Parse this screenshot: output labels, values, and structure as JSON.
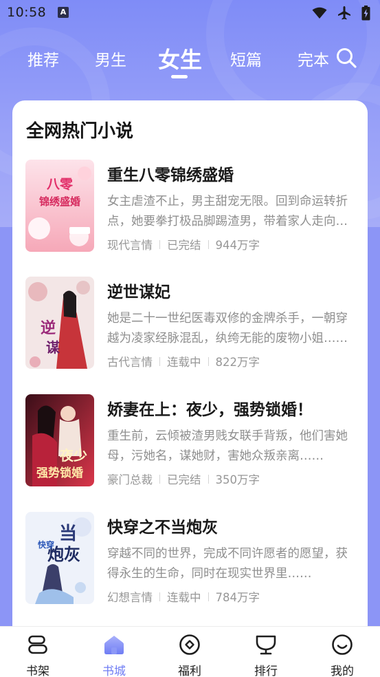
{
  "status_bar": {
    "time": "10:58",
    "notification_badge": "A",
    "icons": [
      "wifi-icon",
      "airplane-mode-icon",
      "battery-charging-icon"
    ]
  },
  "tabs": [
    {
      "label": "推荐",
      "active": false
    },
    {
      "label": "男生",
      "active": false
    },
    {
      "label": "女生",
      "active": true
    },
    {
      "label": "短篇",
      "active": false
    },
    {
      "label": "完本",
      "active": false
    }
  ],
  "search": {
    "icon": "search-icon"
  },
  "section": {
    "title": "全网热门小说"
  },
  "books": [
    {
      "title": "重生八零锦绣盛婚",
      "description": "女主虐渣不止，男主甜宠无限。回到命运转折点，她要拳打极品脚踢渣男，带着家人走向致富之路……",
      "category": "现代言情",
      "status": "已完结",
      "word_count": "944万字",
      "cover_text": "重生八零锦绣盛婚",
      "cover_colors": [
        "#f6a8b8",
        "#fde3ea"
      ]
    },
    {
      "title": "逆世谋妃",
      "description": "她是二十一世纪医毒双修的金牌杀手，一朝穿越为凌家经脉混乱，纨绔无能的废物小姐……",
      "category": "古代言情",
      "status": "连载中",
      "word_count": "822万字",
      "cover_text": "逆世谋妃",
      "cover_colors": [
        "#f0d6d8",
        "#c23a3a"
      ]
    },
    {
      "title": "娇妻在上：夜少，强势锁婚！",
      "description": "重生前，云倾被渣男贱女联手背叛，他们害她母，污她名，谋她财，害她众叛亲离……",
      "category": "豪门总裁",
      "status": "已完结",
      "word_count": "350万字",
      "cover_text": "夜少强势锁婚",
      "cover_colors": [
        "#d9364a",
        "#4a1020"
      ]
    },
    {
      "title": "快穿之不当炮灰",
      "description": "穿越不同的世界，完成不同许愿者的愿望，获得永生的生命，同时在现实世界里……",
      "category": "幻想言情",
      "status": "连载中",
      "word_count": "784万字",
      "cover_text": "快穿之不当炮灰",
      "cover_colors": [
        "#e8eef8",
        "#2b3a78"
      ]
    }
  ],
  "bottom_nav": [
    {
      "label": "书架",
      "icon": "bookshelf-icon",
      "active": false
    },
    {
      "label": "书城",
      "icon": "bookstore-home-icon",
      "active": true
    },
    {
      "label": "福利",
      "icon": "welfare-icon",
      "active": false
    },
    {
      "label": "排行",
      "icon": "ranking-trophy-icon",
      "active": false
    },
    {
      "label": "我的",
      "icon": "profile-smile-icon",
      "active": false
    }
  ],
  "colors": {
    "header_gradient_top": "#7f8cf7",
    "header_gradient_bottom": "#a6acf8",
    "accent": "#6f7df4",
    "title_text": "#1a1a1a",
    "muted_text": "#8f8f8f"
  }
}
